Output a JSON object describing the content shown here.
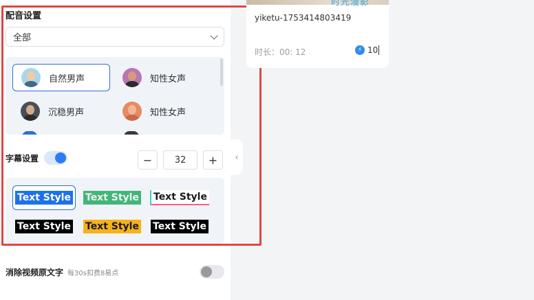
{
  "voice": {
    "title": "配音设置",
    "select_value": "全部",
    "items": [
      {
        "label": "自然男声",
        "icon": "male-avatar-icon",
        "skin": "#f2c9a5",
        "shirt": "#3f6a8a",
        "bg": "#a9d6ee",
        "active": true
      },
      {
        "label": "知性女声",
        "icon": "female-avatar-icon",
        "skin": "#d79a7a",
        "shirt": "#2a2a2a",
        "bg": "#b877b4",
        "active": false
      },
      {
        "label": "沉稳男声",
        "icon": "male-avatar-icon",
        "skin": "#d6a987",
        "shirt": "#2c2c2c",
        "bg": "#4a4f57",
        "active": false
      },
      {
        "label": "知性女声",
        "icon": "female-avatar-icon",
        "skin": "#f0b89a",
        "shirt": "#c86a4a",
        "bg": "#e58b5f",
        "active": false
      }
    ]
  },
  "subtitle": {
    "label": "字幕设置",
    "enabled": true,
    "font_size": "32",
    "minus": "−",
    "plus": "+",
    "styles": [
      {
        "text": "Text Style",
        "color": "#ffffff",
        "bg": "#1d72e8",
        "active": true
      },
      {
        "text": "Text Style",
        "color": "#e9f7ee",
        "bg": "#44b57a",
        "active": false
      },
      {
        "text": "Text Style",
        "color": "#1a1a1a",
        "bg": "#ffffff",
        "border": "#ff5a8a",
        "active": false
      },
      {
        "text": "Text Style",
        "color": "#ffffff",
        "bg": "#000000",
        "active": false
      },
      {
        "text": "Text Style",
        "color": "#1a1a1a",
        "bg": "#f5b21a",
        "active": false
      },
      {
        "text": "Text Style",
        "color": "#ffffff",
        "bg": "#000000",
        "active": false
      }
    ]
  },
  "erase": {
    "label": "消除视频原文字",
    "note": "每30s扣费8易点",
    "enabled": false
  },
  "card": {
    "thumb_text": "时光漫影",
    "name": "yiketu-1753414803419",
    "duration": "时长：00: 12",
    "points": "10"
  },
  "colors": {
    "accent": "#2f6fd6",
    "toggle_on": "#2d7cf6",
    "toggle_track": "#dce7fb",
    "highlight": "#e5443f"
  }
}
